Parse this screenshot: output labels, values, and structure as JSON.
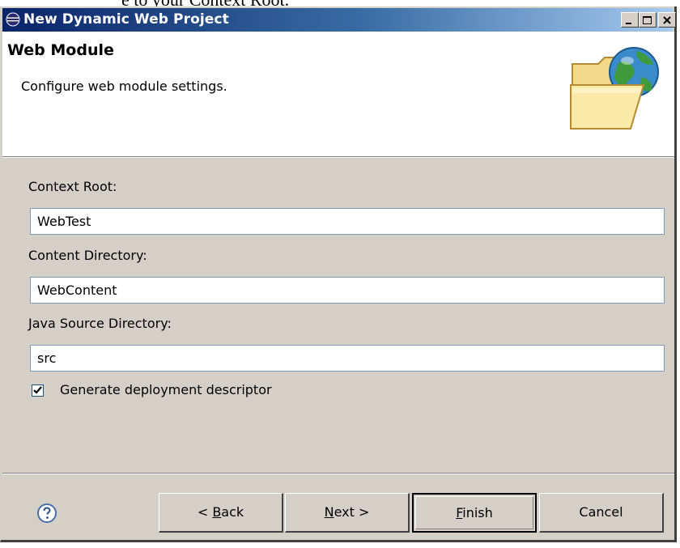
{
  "top_cut_text": "e to your Context Root.",
  "window": {
    "title": "New Dynamic Web Project",
    "controls": [
      "minimize",
      "maximize",
      "close"
    ]
  },
  "banner": {
    "title": "Web Module",
    "description": "Configure web module settings.",
    "icon": "globe-folder-icon"
  },
  "form": {
    "context_root": {
      "label": "Context Root:",
      "value": "WebTest"
    },
    "content_dir": {
      "label": "Content Directory:",
      "value": "WebContent"
    },
    "java_src_dir": {
      "label": "Java Source Directory:",
      "value": "src"
    },
    "generate_dd": {
      "label": "Generate deployment descriptor",
      "checked": true
    }
  },
  "buttons": {
    "help": "help-icon",
    "back": {
      "prefix": "< ",
      "mnemonic": "B",
      "rest": "ack"
    },
    "next": {
      "mnemonic": "N",
      "rest": "ext >"
    },
    "finish": {
      "mnemonic": "F",
      "rest": "inish"
    },
    "cancel": "Cancel"
  },
  "colors": {
    "titlebar_start": "#0a246a",
    "titlebar_end": "#a6caf0",
    "dialog_bg": "#d4d0c8",
    "field_border": "#7f9db9"
  }
}
